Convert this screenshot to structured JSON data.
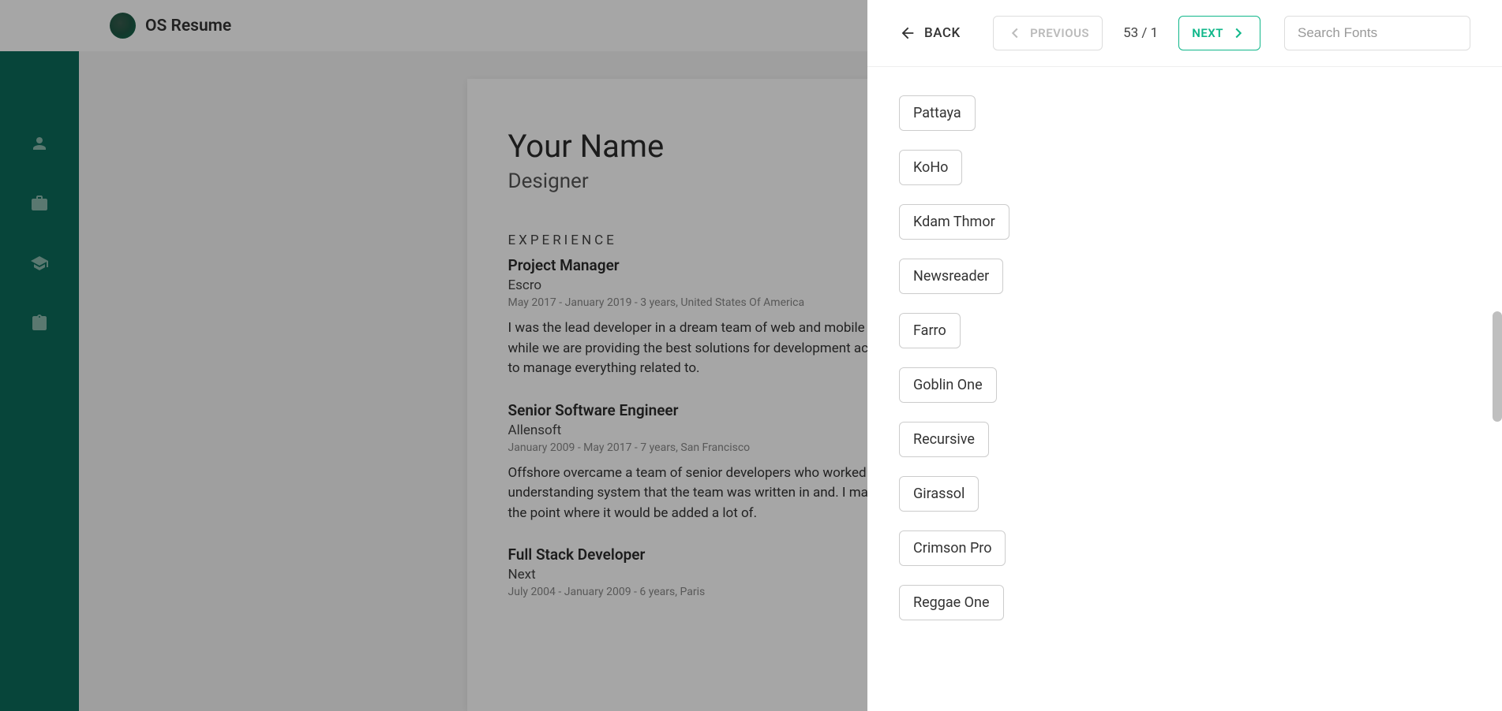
{
  "header": {
    "title": "OS Resume"
  },
  "sidebar": {
    "icons": [
      "person",
      "briefcase",
      "education",
      "clipboard"
    ]
  },
  "resume": {
    "name": "Your Name",
    "title": "Designer",
    "section_experience": "EXPERIENCE",
    "jobs": [
      {
        "title": "Project Manager",
        "company": "Escro",
        "meta": "May 2017 - January 2019 - 3 years, United States Of America",
        "desc": "I was the lead developer in a dream team of web and mobile applications and web designers, while we are providing the best solutions for development account managers and developers to manage everything related to."
      },
      {
        "title": "Senior Software Engineer",
        "company": "Allensoft",
        "meta": "January 2009 - May 2017 - 7 years, San Francisco",
        "desc": "Offshore overcame a team of senior developers who worked on the development of an intern understanding system that the team was written in and. I maintained the company platform to the point where it would be added a lot of."
      },
      {
        "title": "Full Stack Developer",
        "company": "Next",
        "meta": "July 2004 - January 2009 - 6 years, Paris",
        "desc": ""
      }
    ]
  },
  "panel": {
    "back_label": "BACK",
    "prev_label": "PREVIOUS",
    "next_label": "NEXT",
    "page_indicator": "53 / 1",
    "search_placeholder": "Search Fonts",
    "fonts": [
      "Pattaya",
      "KoHo",
      "Kdam Thmor",
      "Newsreader",
      "Farro",
      "Goblin One",
      "Recursive",
      "Girassol",
      "Crimson Pro",
      "Reggae One"
    ]
  }
}
